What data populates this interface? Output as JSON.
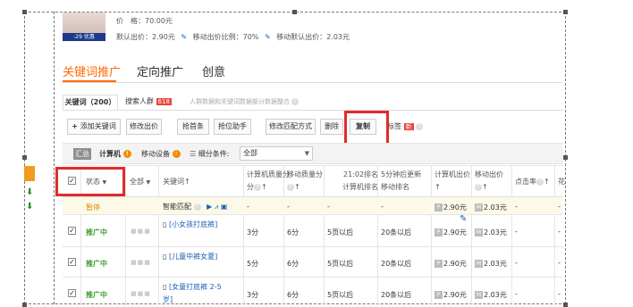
{
  "product": {
    "price_label": "价　格：",
    "price": "70.00元",
    "default_bid_label": "默认出价：",
    "default_bid": "2.90元",
    "mobile_ratio_label": "移动出价比例：",
    "mobile_ratio": "70%",
    "mobile_default_label": "移动默认出价：",
    "mobile_default": "2.03元",
    "thumb_text": "-29 优惠"
  },
  "main_tabs": [
    {
      "label": "关键词推广"
    },
    {
      "label": "定向推广"
    },
    {
      "label": "创意"
    }
  ],
  "sub_tabs": {
    "keywords": "关键词（200）",
    "crowd": "搜索人群",
    "crowd_badge": "618",
    "note": "人群数据和关键词数据部分数据整合"
  },
  "toolbar": {
    "add": "添加关键词",
    "edit_bid": "修改出价",
    "grab": "抢首条",
    "grab_helper": "抢位助手",
    "match": "修改匹配方式",
    "delete": "删除",
    "copy": "复制",
    "tag": "标签",
    "tag_badge": "新"
  },
  "filters": {
    "summary": "汇总",
    "computer": "计算机",
    "mobile": "移动设备",
    "sub_label": "细分条件:",
    "sub_value": "全部"
  },
  "headers": {
    "status": "状态",
    "all": "全部",
    "keyword": "关键词",
    "pc_quality": "计算机质量分",
    "mobile_quality": "移动质量分",
    "time": "21:02排名",
    "pc_rank": "计算机排名",
    "update": "5分钟后更新",
    "mobile_rank": "移动排名",
    "pc_bid": "计算机出价",
    "mobile_bid": "移动出价",
    "ctr": "点击率",
    "cost": "花"
  },
  "group_row": {
    "status": "暂停",
    "keyword": "智能匹配",
    "pc_quality": "-",
    "mobile_quality": "-",
    "pc_rank": "-",
    "mobile_rank": "-",
    "pc_bid": "2.90元",
    "mobile_bid": "2.03元",
    "ctr": "-",
    "cost": "-"
  },
  "rows": [
    {
      "status": "推广中",
      "keyword": "[小女孩打底裤]",
      "pc_quality": "3分",
      "mobile_quality": "6分",
      "pc_rank": "5页以后",
      "mobile_rank": "20条以后",
      "pc_bid": "2.90元",
      "mobile_bid": "2.03元",
      "ctr": "-",
      "cost": "-"
    },
    {
      "status": "推广中",
      "keyword": "[儿童中裤女夏]",
      "pc_quality": "5分",
      "mobile_quality": "6分",
      "pc_rank": "5页以后",
      "mobile_rank": "20条以后",
      "pc_bid": "2.90元",
      "mobile_bid": "2.03元",
      "ctr": "-",
      "cost": "-"
    },
    {
      "status": "推广中",
      "keyword": "[女童打底裤 2-5岁]",
      "pc_quality": "3分",
      "mobile_quality": "6分",
      "pc_rank": "5页以后",
      "mobile_rank": "20条以后",
      "pc_bid": "2.90元",
      "mobile_bid": "2.03元",
      "ctr": "-",
      "cost": "-"
    }
  ],
  "colors": {
    "accent": "#ff6a00",
    "status_green": "#3f9d2e",
    "highlight": "#e12b2b"
  }
}
